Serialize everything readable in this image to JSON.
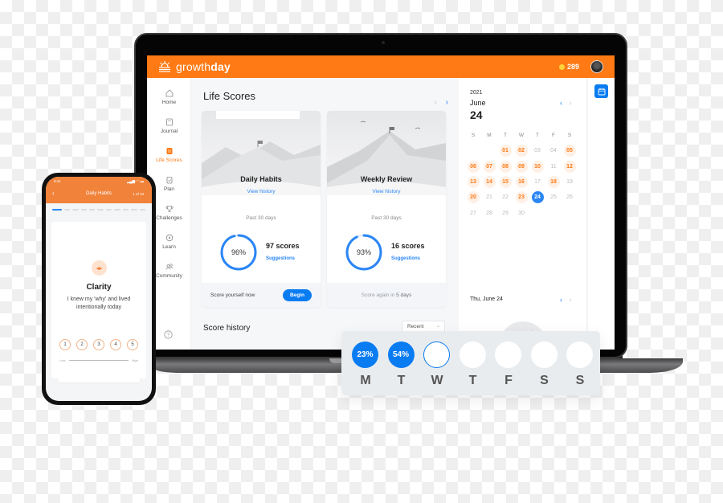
{
  "app": {
    "brand_light": "growth",
    "brand_bold": "day",
    "coins": "289",
    "accent_color": "#ff7a14",
    "primary_color": "#0a7cf2"
  },
  "sidebar": {
    "items": [
      {
        "label": "Home",
        "icon": "home-icon"
      },
      {
        "label": "Journal",
        "icon": "journal-icon"
      },
      {
        "label": "Life Scores",
        "icon": "life-scores-icon",
        "active": true
      },
      {
        "label": "Plan",
        "icon": "clipboard-icon"
      },
      {
        "label": "Challenges",
        "icon": "trophy-icon"
      },
      {
        "label": "Learn",
        "icon": "play-icon"
      },
      {
        "label": "Community",
        "icon": "people-icon"
      }
    ],
    "help_icon": "help-icon"
  },
  "main": {
    "title": "Life Scores",
    "cards": [
      {
        "title": "Daily Habits",
        "link": "View history",
        "period": "Past 30 days",
        "percent": 96,
        "percent_label": "96%",
        "scores": "97 scores",
        "suggestions": "Suggestions",
        "footer_text": "Score yourself now",
        "footer_button": "Begin"
      },
      {
        "title": "Weekly Review",
        "link": "View history",
        "period": "Past 30 days",
        "percent": 93,
        "percent_label": "93%",
        "scores": "16 scores",
        "suggestions": "Suggestions",
        "footer_prefix": "Score again in ",
        "footer_days": "5 days"
      }
    ],
    "history_title": "Score history",
    "sort_value": "Recent"
  },
  "calendar": {
    "year": "2021",
    "month": "June",
    "day": "24",
    "weekdays": [
      "S",
      "M",
      "T",
      "W",
      "T",
      "F",
      "S"
    ],
    "weeks": [
      [
        null,
        null,
        {
          "d": "01",
          "s": 1
        },
        {
          "d": "02",
          "s": 1
        },
        {
          "d": "03"
        },
        {
          "d": "04"
        },
        {
          "d": "05",
          "s": 1
        }
      ],
      [
        {
          "d": "06",
          "s": 1
        },
        {
          "d": "07",
          "s": 1
        },
        {
          "d": "08",
          "s": 1
        },
        {
          "d": "09",
          "s": 1
        },
        {
          "d": "10",
          "s": 1
        },
        {
          "d": "11"
        },
        {
          "d": "12",
          "s": 1
        }
      ],
      [
        {
          "d": "13",
          "s": 1
        },
        {
          "d": "14",
          "s": 1
        },
        {
          "d": "15",
          "s": 1
        },
        {
          "d": "16",
          "s": 1
        },
        {
          "d": "17"
        },
        {
          "d": "18",
          "s": 1
        },
        {
          "d": "19"
        }
      ],
      [
        {
          "d": "20",
          "s": 1
        },
        {
          "d": "21"
        },
        {
          "d": "22"
        },
        {
          "d": "23",
          "s": 1
        },
        {
          "d": "24",
          "t": 1
        },
        {
          "d": "25"
        },
        {
          "d": "26"
        }
      ],
      [
        {
          "d": "27"
        },
        {
          "d": "28"
        },
        {
          "d": "29"
        },
        {
          "d": "30"
        },
        null,
        null,
        null
      ]
    ],
    "selected_date": "Thu, June 24"
  },
  "week_tracker": {
    "days": [
      {
        "label": "M",
        "value": "23%",
        "state": "filled"
      },
      {
        "label": "T",
        "value": "54%",
        "state": "filled"
      },
      {
        "label": "W",
        "value": "",
        "state": "current"
      },
      {
        "label": "T",
        "value": "",
        "state": "empty"
      },
      {
        "label": "F",
        "value": "",
        "state": "empty"
      },
      {
        "label": "S",
        "value": "",
        "state": "empty"
      },
      {
        "label": "S",
        "value": "",
        "state": "empty"
      }
    ]
  },
  "phone": {
    "time": "9:41",
    "status": "▂▄▆ ◠ ▬",
    "back": "‹",
    "title": "Daily Habits",
    "step": "1 of 10",
    "progress_total": 11,
    "progress_done": 1,
    "habit_title": "Clarity",
    "habit_desc": "I knew my 'why' and lived intentionally today",
    "ratings": [
      "1",
      "2",
      "3",
      "4",
      "5"
    ],
    "scale_low": "Low",
    "scale_high": "High"
  }
}
